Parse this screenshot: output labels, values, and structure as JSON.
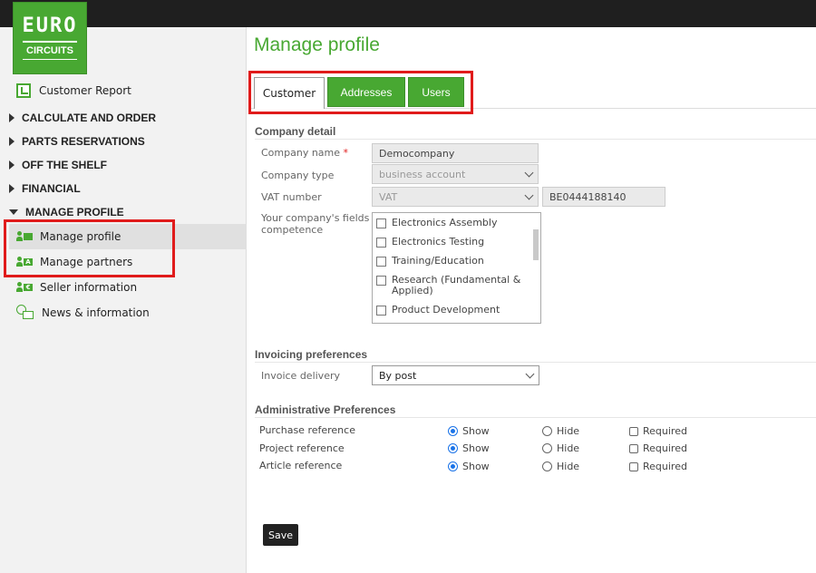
{
  "logo": {
    "line1": "EURO",
    "line2": "CIRCUITS"
  },
  "sidebar": {
    "report": "Customer Report",
    "categories": [
      {
        "label": "CALCULATE AND ORDER"
      },
      {
        "label": "PARTS RESERVATIONS"
      },
      {
        "label": "OFF THE SHELF"
      },
      {
        "label": "FINANCIAL"
      },
      {
        "label": "MANAGE PROFILE"
      }
    ],
    "sub_items": [
      {
        "label": "Manage profile",
        "icon": "user-card-icon",
        "active": true
      },
      {
        "label": "Manage partners",
        "icon": "user-card-a-icon"
      },
      {
        "label": "Seller information",
        "icon": "user-euro-icon"
      },
      {
        "label": "News & information",
        "icon": "globe-envelope-icon"
      }
    ]
  },
  "main": {
    "title": "Manage profile",
    "tabs": [
      "Customer",
      "Addresses",
      "Users"
    ],
    "company_detail": {
      "heading": "Company detail",
      "company_name_label": "Company name",
      "company_name_value": "Democompany",
      "company_type_label": "Company type",
      "company_type_value": "business account",
      "vat_label": "VAT number",
      "vat_select": "VAT",
      "vat_value": "BE0444188140",
      "fields_label_1": "Your company's fields of",
      "fields_label_2": "competence",
      "fields_options": [
        "Electronics Assembly",
        "Electronics Testing",
        "Training/Education",
        "Research (Fundamental &",
        "Applied)",
        "Product Development"
      ]
    },
    "invoicing": {
      "heading": "Invoicing preferences",
      "delivery_label": "Invoice delivery",
      "delivery_value": "By post"
    },
    "admin": {
      "heading": "Administrative Preferences",
      "rows": [
        {
          "label": "Purchase reference",
          "show": "Show",
          "hide": "Hide",
          "required": "Required"
        },
        {
          "label": "Project reference",
          "show": "Show",
          "hide": "Hide",
          "required": "Required"
        },
        {
          "label": "Article reference",
          "show": "Show",
          "hide": "Hide",
          "required": "Required"
        }
      ]
    },
    "save_label": "Save"
  },
  "colors": {
    "brand": "#48a832",
    "highlight": "#e01b1b"
  }
}
